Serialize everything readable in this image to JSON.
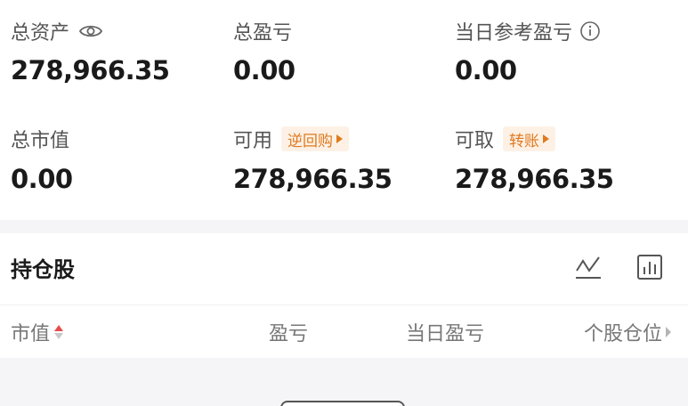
{
  "account": {
    "total_assets_label": "总资产",
    "total_assets_value": "278,966.35",
    "total_pl_label": "总盈亏",
    "total_pl_value": "0.00",
    "daily_pl_label": "当日参考盈亏",
    "daily_pl_value": "0.00",
    "market_value_label": "总市值",
    "market_value_value": "0.00",
    "available_label": "可用",
    "available_tag": "逆回购",
    "available_value": "278,966.35",
    "withdrawable_label": "可取",
    "withdrawable_tag": "转账",
    "withdrawable_value": "278,966.35"
  },
  "holdings": {
    "title": "持仓股",
    "columns": [
      "市值",
      "盈亏",
      "当日盈亏",
      "个股仓位"
    ]
  },
  "icons": {
    "visibility": "eye-icon",
    "info": "info-icon",
    "trend": "trend-chart-icon",
    "bar": "bar-chart-icon"
  },
  "colors": {
    "tag_text": "#e07a1f",
    "tag_bg": "#fdf1e6",
    "sort_active": "#e84b4b"
  }
}
